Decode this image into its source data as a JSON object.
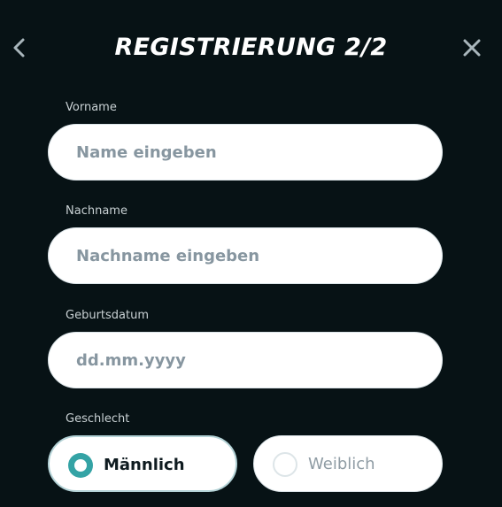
{
  "header": {
    "title": "REGISTRIERUNG 2/2",
    "back_icon": "chevron-left-icon",
    "close_icon": "close-icon"
  },
  "form": {
    "first_name": {
      "label": "Vorname",
      "placeholder": "Name eingeben",
      "value": ""
    },
    "last_name": {
      "label": "Nachname",
      "placeholder": "Nachname eingeben",
      "value": ""
    },
    "birth_date": {
      "label": "Geburtsdatum",
      "placeholder": "dd.mm.yyyy",
      "value": ""
    },
    "gender": {
      "label": "Geschlecht",
      "selected": "male",
      "options": [
        {
          "id": "male",
          "label": "Männlich"
        },
        {
          "id": "female",
          "label": "Weiblich"
        }
      ]
    }
  },
  "colors": {
    "background": "#071215",
    "accent": "#34a3a5",
    "input_background": "#ffffff",
    "placeholder": "#8796a0"
  }
}
